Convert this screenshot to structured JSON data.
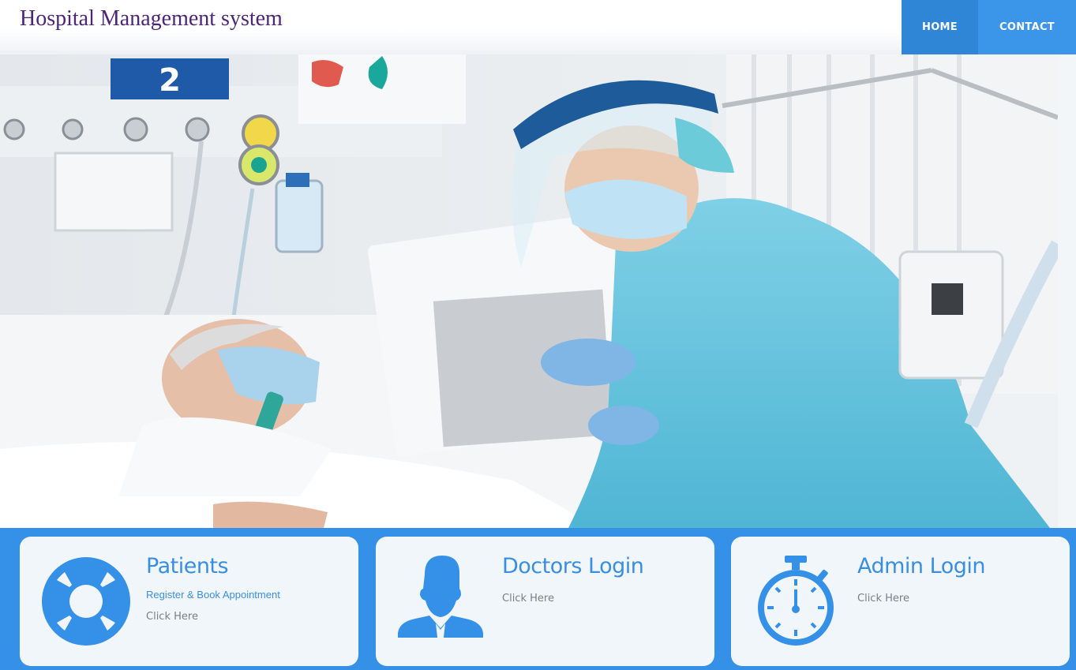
{
  "header": {
    "title": "Hospital Management system",
    "nav": [
      {
        "label": "HOME"
      },
      {
        "label": "CONTACT"
      }
    ]
  },
  "hero": {
    "room_number": "2",
    "image": "hospital-icu-doctor-patient-photo"
  },
  "cards": [
    {
      "title": "Patients",
      "subtitle": "Register & Book Appointment",
      "link": "Click Here",
      "icon": "lifebuoy-icon"
    },
    {
      "title": "Doctors Login",
      "link": "Click Here",
      "icon": "doctor-icon"
    },
    {
      "title": "Admin Login",
      "link": "Click Here",
      "icon": "stopwatch-icon"
    }
  ],
  "colors": {
    "accent": "#3591e7",
    "nav_home": "#2f86d6",
    "nav_contact": "#3b95e9",
    "brand_text": "#4b2677",
    "card_bg": "#f1f6fa"
  }
}
